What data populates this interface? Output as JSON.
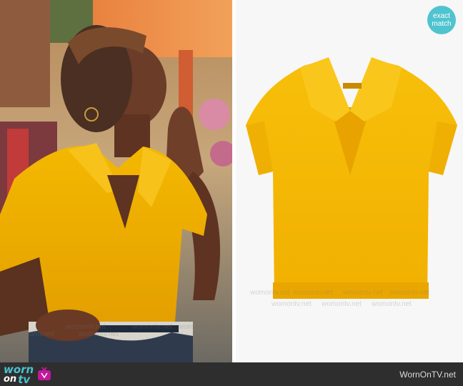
{
  "badge": {
    "line1": "exact",
    "line2": "match"
  },
  "watermark": {
    "text": "womontv.net"
  },
  "footer": {
    "logo_line1": "worn",
    "logo_line2": "on",
    "logo_line3": "tv",
    "site_name": "WornOnTV.net"
  },
  "colors": {
    "badge": "#4fc4cf",
    "footer_bg": "#2e2e2e",
    "logo_accent": "#49c2d0",
    "shirt": "#f2b705"
  },
  "images": {
    "left": "woman-in-yellow-polo-photo",
    "right": "yellow-knit-polo-product-photo"
  }
}
